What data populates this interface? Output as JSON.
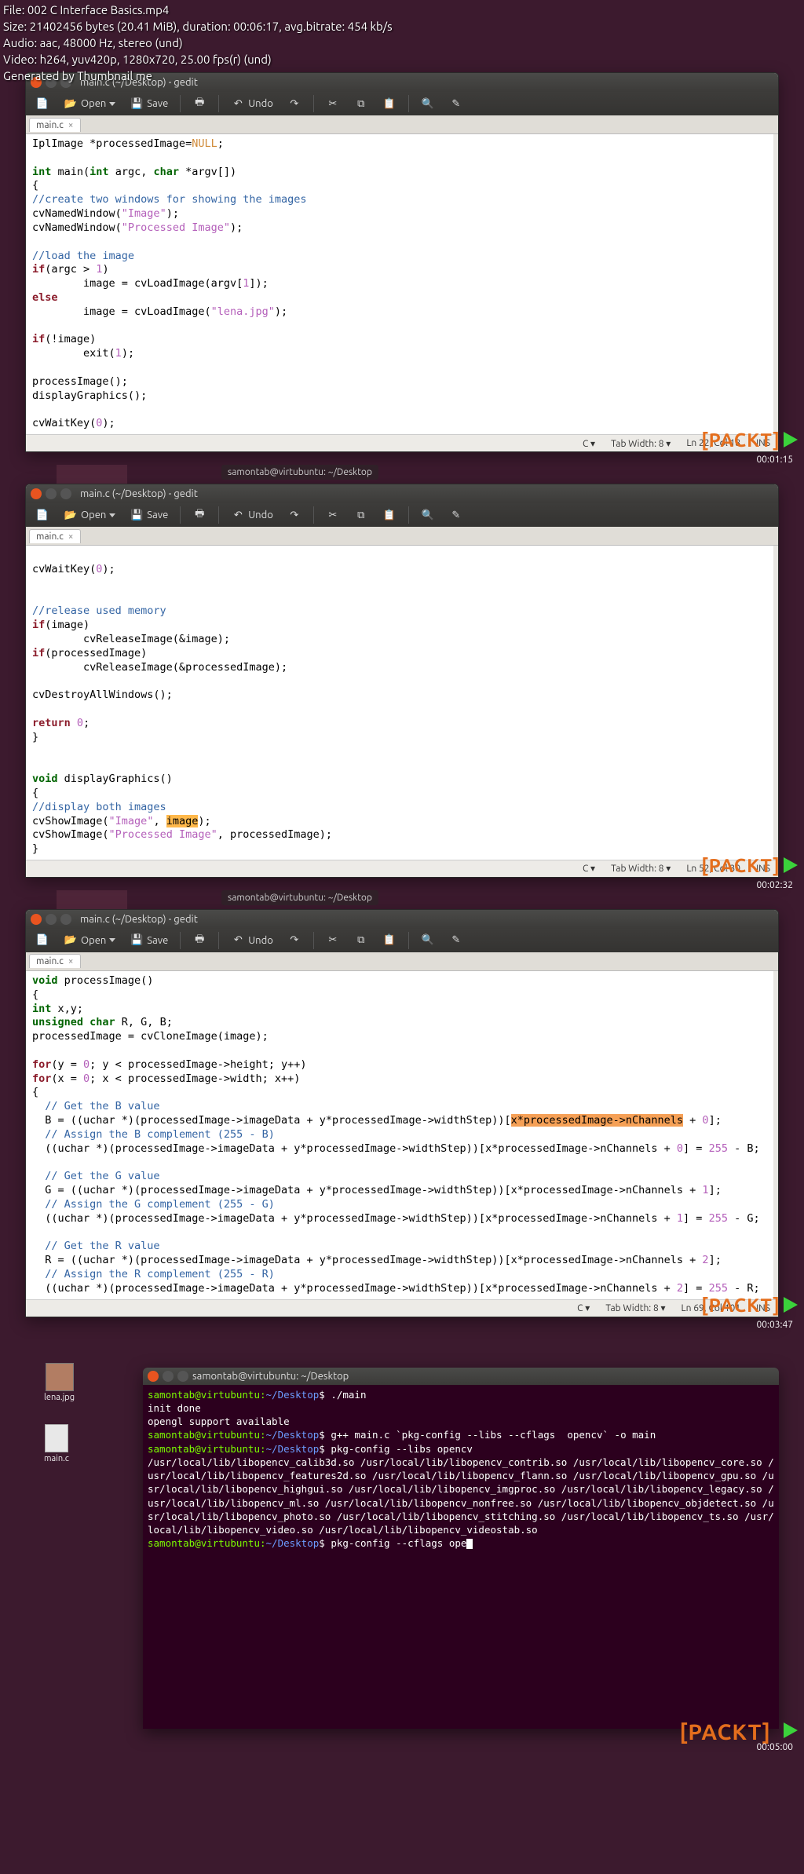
{
  "meta": {
    "file": "File: 002 C Interface Basics.mp4",
    "size": "Size: 21402456 bytes (20.41 MiB), duration: 00:06:17, avg.bitrate: 454 kb/s",
    "audio": "Audio: aac, 48000 Hz, stereo (und)",
    "video": "Video: h264, yuv420p, 1280x720, 25.00 fps(r) (und)",
    "gen": "Generated by Thumbnail me"
  },
  "toolbar": {
    "open": "Open",
    "save": "Save",
    "undo": "Undo"
  },
  "window": {
    "title": "main.c (~/Desktop) - gedit",
    "tab": "main.c"
  },
  "status": {
    "lang": "C ▾",
    "tabwidth": "Tab Width: 8 ▾",
    "pos1": "Ln 22, Col 18",
    "pos2": "Ln 52, Col 30",
    "pos3": "Ln 69, Col 101",
    "ins": "INS"
  },
  "timestamps": {
    "t1": "00:01:15",
    "t2": "00:02:32",
    "t3": "00:03:47",
    "t4": "00:05:00"
  },
  "taskbar": {
    "frag": "samontab@virtubuntu: ~/Desktop"
  },
  "packt": "[PACKT]",
  "desktop": {
    "icon1": "lena.jpg",
    "icon2": "main.c"
  },
  "term": {
    "title": "samontab@virtubuntu: ~/Desktop",
    "prompt": "samontab@virtubuntu:",
    "path": "~/Desktop",
    "line1": "./main",
    "line2": "init done",
    "line3": "opengl support available",
    "line4": "g++ main.c `pkg-config --libs --cflags  opencv` -o main",
    "line5": "pkg-config --libs opencv",
    "line6": "/usr/local/lib/libopencv_calib3d.so /usr/local/lib/libopencv_contrib.so /usr/local/lib/libopencv_core.so /usr/local/lib/libopencv_features2d.so /usr/local/lib/libopencv_flann.so /usr/local/lib/libopencv_gpu.so /usr/local/lib/libopencv_highgui.so /usr/local/lib/libopencv_imgproc.so /usr/local/lib/libopencv_legacy.so /usr/local/lib/libopencv_ml.so /usr/local/lib/libopencv_nonfree.so /usr/local/lib/libopencv_objdetect.so /usr/local/lib/libopencv_photo.so /usr/local/lib/libopencv_stitching.so /usr/local/lib/libopencv_ts.so /usr/local/lib/libopencv_video.so /usr/local/lib/libopencv_videostab.so",
    "line7": "pkg-config --cflags ope"
  }
}
